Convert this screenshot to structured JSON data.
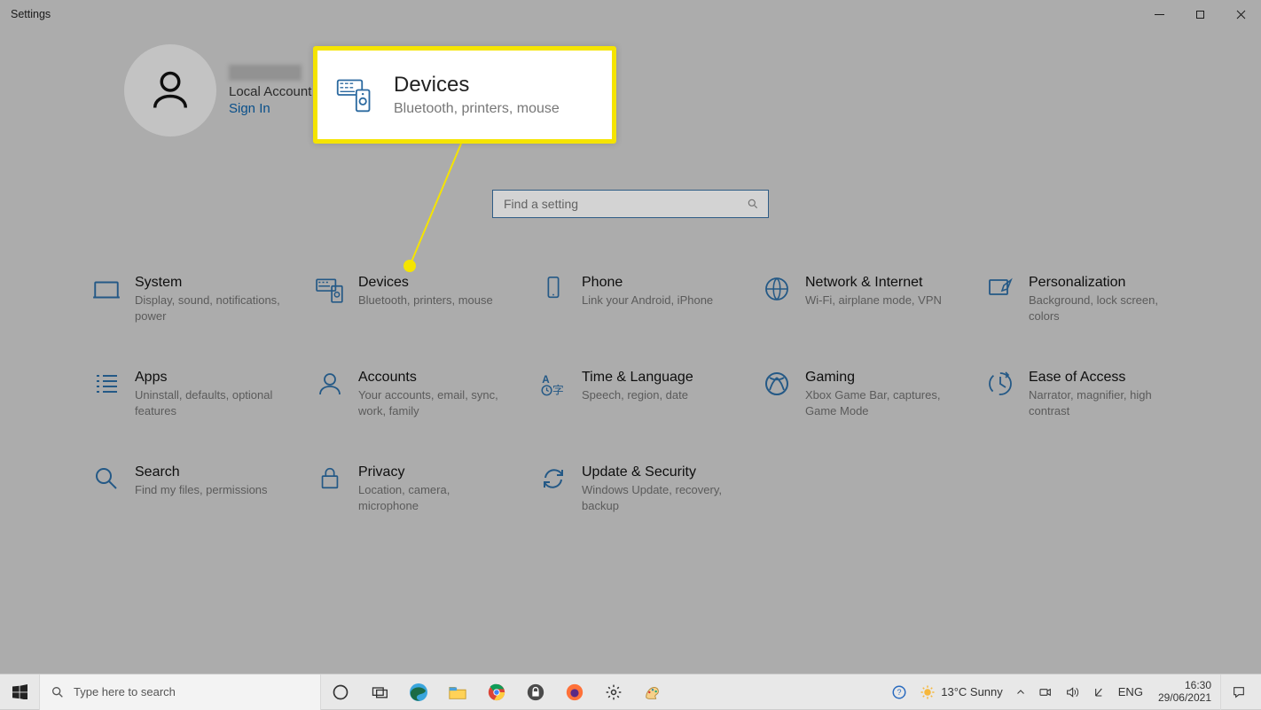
{
  "window": {
    "title": "Settings"
  },
  "user": {
    "account_type": "Local Account",
    "signin_label": "Sign In"
  },
  "callout": {
    "title": "Devices",
    "subtitle": "Bluetooth, printers, mouse"
  },
  "search": {
    "placeholder": "Find a setting"
  },
  "categories": [
    {
      "id": "system",
      "title": "System",
      "subtitle": "Display, sound, notifications, power"
    },
    {
      "id": "devices",
      "title": "Devices",
      "subtitle": "Bluetooth, printers, mouse"
    },
    {
      "id": "phone",
      "title": "Phone",
      "subtitle": "Link your Android, iPhone"
    },
    {
      "id": "network",
      "title": "Network & Internet",
      "subtitle": "Wi-Fi, airplane mode, VPN"
    },
    {
      "id": "personalization",
      "title": "Personalization",
      "subtitle": "Background, lock screen, colors"
    },
    {
      "id": "apps",
      "title": "Apps",
      "subtitle": "Uninstall, defaults, optional features"
    },
    {
      "id": "accounts",
      "title": "Accounts",
      "subtitle": "Your accounts, email, sync, work, family"
    },
    {
      "id": "time",
      "title": "Time & Language",
      "subtitle": "Speech, region, date"
    },
    {
      "id": "gaming",
      "title": "Gaming",
      "subtitle": "Xbox Game Bar, captures, Game Mode"
    },
    {
      "id": "ease",
      "title": "Ease of Access",
      "subtitle": "Narrator, magnifier, high contrast"
    },
    {
      "id": "search",
      "title": "Search",
      "subtitle": "Find my files, permissions"
    },
    {
      "id": "privacy",
      "title": "Privacy",
      "subtitle": "Location, camera, microphone"
    },
    {
      "id": "update",
      "title": "Update & Security",
      "subtitle": "Windows Update, recovery, backup"
    }
  ],
  "taskbar": {
    "search_placeholder": "Type here to search",
    "weather": "13°C  Sunny",
    "lang": "ENG",
    "time": "16:30",
    "date": "29/06/2021"
  }
}
